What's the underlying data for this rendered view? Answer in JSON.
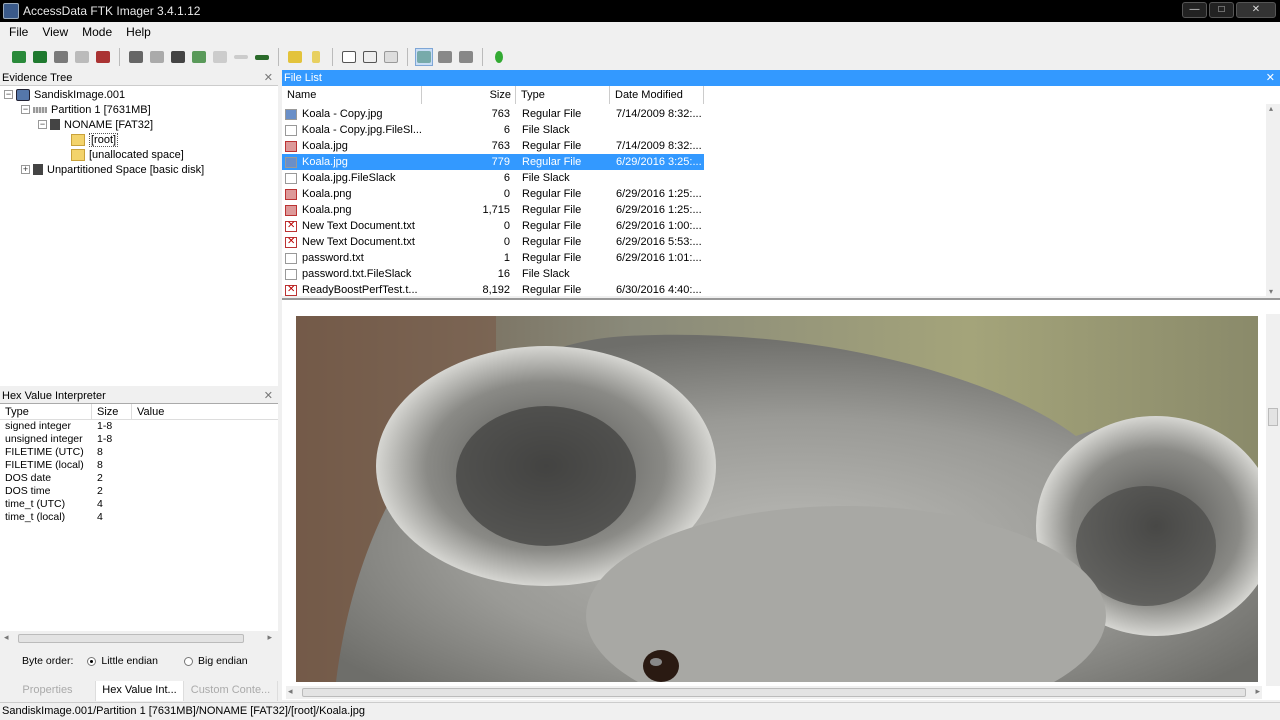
{
  "window": {
    "title": "AccessData FTK Imager 3.4.1.12",
    "buttons": [
      "—",
      "□",
      "✕"
    ]
  },
  "menu": [
    "File",
    "View",
    "Mode",
    "Help"
  ],
  "evidence_tree": {
    "title": "Evidence Tree",
    "nodes": [
      {
        "label": "SandiskImage.001",
        "expander": "−"
      },
      {
        "label": "Partition 1 [7631MB]",
        "expander": "−"
      },
      {
        "label": "NONAME [FAT32]",
        "expander": "−"
      },
      {
        "label": "[root]",
        "expander": ""
      },
      {
        "label": "[unallocated space]",
        "expander": ""
      },
      {
        "label": "Unpartitioned Space [basic disk]",
        "expander": "+"
      }
    ]
  },
  "hex_interpreter": {
    "title": "Hex Value Interpreter",
    "columns": [
      "Type",
      "Size",
      "Value"
    ],
    "rows": [
      {
        "type": "signed integer",
        "size": "1-8"
      },
      {
        "type": "unsigned integer",
        "size": "1-8"
      },
      {
        "type": "FILETIME (UTC)",
        "size": "8"
      },
      {
        "type": "FILETIME (local)",
        "size": "8"
      },
      {
        "type": "DOS date",
        "size": "2"
      },
      {
        "type": "DOS time",
        "size": "2"
      },
      {
        "type": "time_t (UTC)",
        "size": "4"
      },
      {
        "type": "time_t (local)",
        "size": "4"
      }
    ],
    "byte_order_label": "Byte order:",
    "little_endian": "Little endian",
    "big_endian": "Big endian"
  },
  "bottom_tabs": [
    "Properties",
    "Hex Value Int...",
    "Custom Conte..."
  ],
  "file_list": {
    "title": "File List",
    "columns": [
      "Name",
      "Size",
      "Type",
      "Date Modified"
    ],
    "rows": [
      {
        "name": "Koala - Copy.jpg",
        "size": "763",
        "type": "Regular File",
        "date": "7/14/2009 8:32:...",
        "icon": "pic"
      },
      {
        "name": "Koala - Copy.jpg.FileSl...",
        "size": "6",
        "type": "File Slack",
        "date": "",
        "icon": "blank"
      },
      {
        "name": "Koala.jpg",
        "size": "763",
        "type": "Regular File",
        "date": "7/14/2009 8:32:...",
        "icon": "delpic"
      },
      {
        "name": "Koala.jpg",
        "size": "779",
        "type": "Regular File",
        "date": "6/29/2016 3:25:...",
        "icon": "pic"
      },
      {
        "name": "Koala.jpg.FileSlack",
        "size": "6",
        "type": "File Slack",
        "date": "",
        "icon": "blank"
      },
      {
        "name": "Koala.png",
        "size": "0",
        "type": "Regular File",
        "date": "6/29/2016 1:25:...",
        "icon": "delpic"
      },
      {
        "name": "Koala.png",
        "size": "1,715",
        "type": "Regular File",
        "date": "6/29/2016 1:25:...",
        "icon": "delpic"
      },
      {
        "name": "New Text Document.txt",
        "size": "0",
        "type": "Regular File",
        "date": "6/29/2016 1:00:...",
        "icon": "del"
      },
      {
        "name": "New Text Document.txt",
        "size": "0",
        "type": "Regular File",
        "date": "6/29/2016 5:53:...",
        "icon": "del"
      },
      {
        "name": "password.txt",
        "size": "1",
        "type": "Regular File",
        "date": "6/29/2016 1:01:...",
        "icon": "blank"
      },
      {
        "name": "password.txt.FileSlack",
        "size": "16",
        "type": "File Slack",
        "date": "",
        "icon": "blank"
      },
      {
        "name": "ReadyBoostPerfTest.t...",
        "size": "8,192",
        "type": "Regular File",
        "date": "6/30/2016 4:40:...",
        "icon": "del"
      }
    ],
    "selected_index": 3
  },
  "status_path": "SandiskImage.001/Partition 1 [7631MB]/NONAME [FAT32]/[root]/Koala.jpg",
  "colors": {
    "selection": "#3399ff",
    "titlebar": "#000000",
    "panel_header_active": "#3399ff"
  }
}
